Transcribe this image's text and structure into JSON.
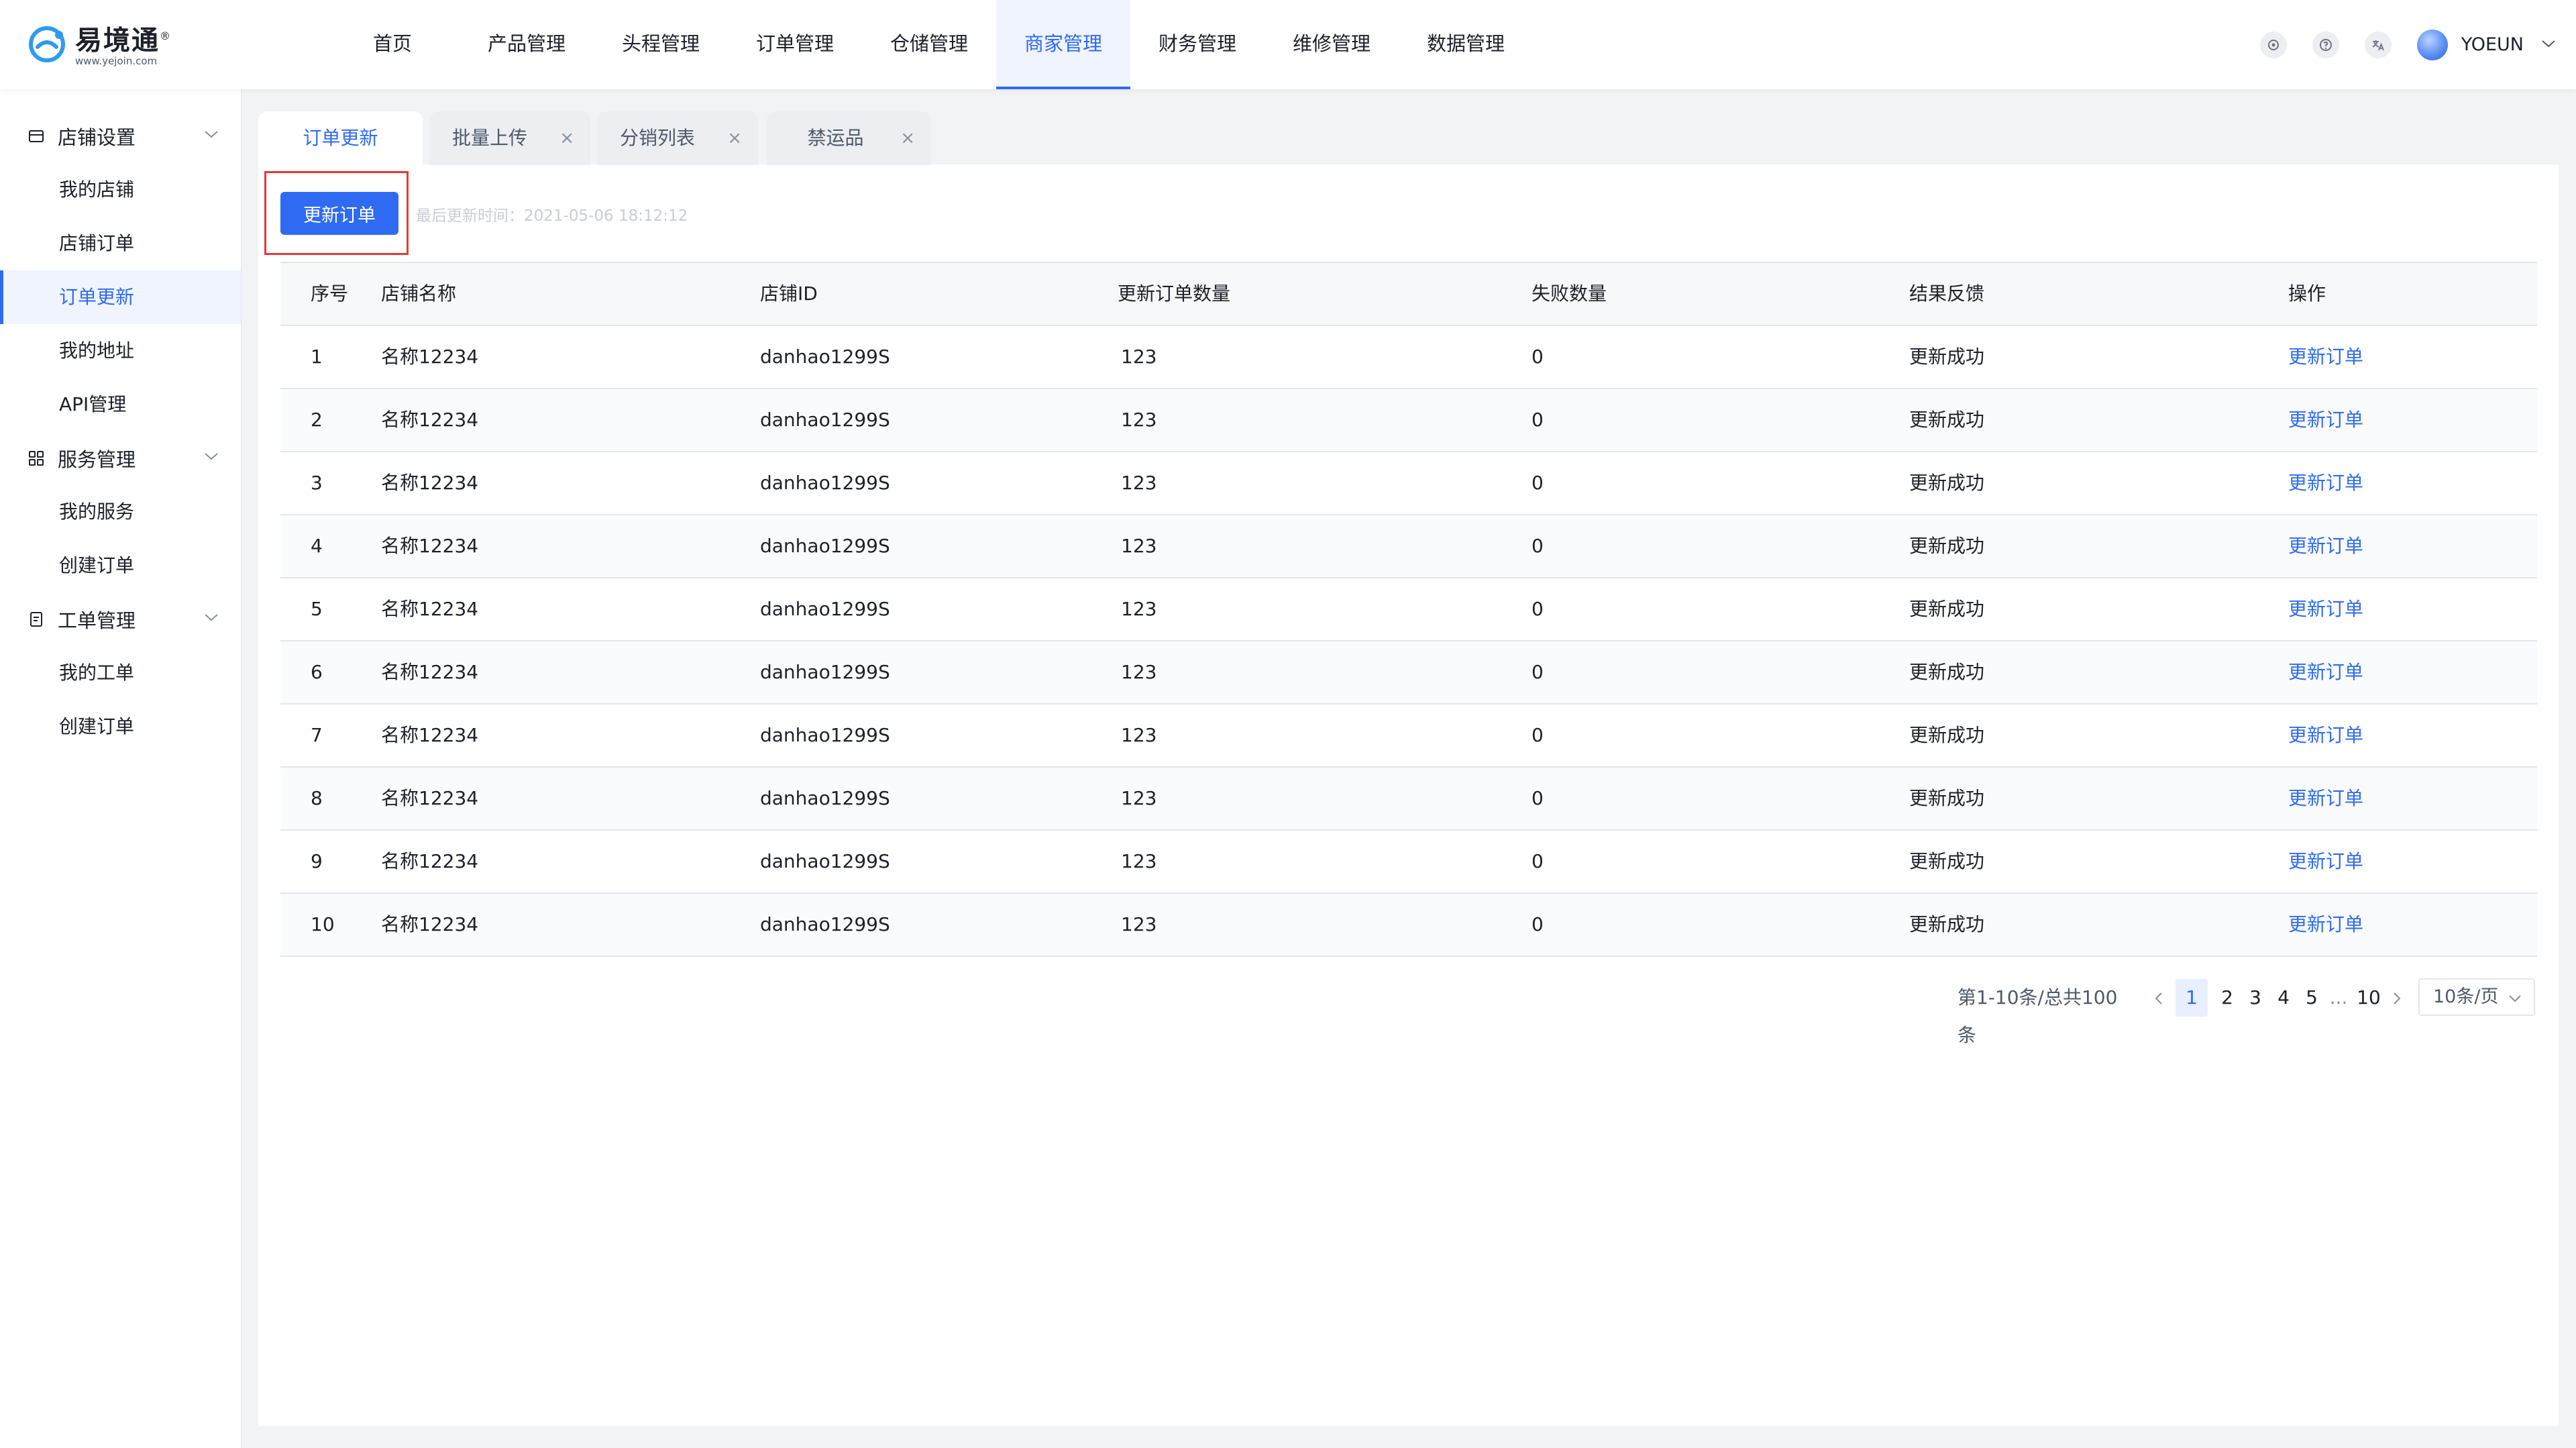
{
  "brand": {
    "name": "易境通",
    "mark": "®",
    "url": "www.yejoin.com"
  },
  "nav": [
    {
      "label": "首页"
    },
    {
      "label": "产品管理"
    },
    {
      "label": "头程管理"
    },
    {
      "label": "订单管理"
    },
    {
      "label": "仓储管理"
    },
    {
      "label": "商家管理",
      "active": true
    },
    {
      "label": "财务管理"
    },
    {
      "label": "维修管理"
    },
    {
      "label": "数据管理"
    }
  ],
  "header_icons": [
    "settings-icon",
    "help-icon",
    "translate-icon"
  ],
  "user": {
    "name": "YOEUN"
  },
  "sidebar": {
    "groups": [
      {
        "title": "店铺设置",
        "icon": "store-icon",
        "items": [
          "我的店铺",
          "店铺订单",
          "订单更新",
          "我的地址",
          "API管理"
        ]
      },
      {
        "title": "服务管理",
        "icon": "grid-icon",
        "items": [
          "我的服务",
          "创建订单"
        ]
      },
      {
        "title": "工单管理",
        "icon": "ticket-icon",
        "items": [
          "我的工单",
          "创建订单"
        ]
      }
    ],
    "active_item": "订单更新"
  },
  "tabs": [
    {
      "label": "订单更新",
      "active": true
    },
    {
      "label": "批量上传",
      "closable": true
    },
    {
      "label": "分销列表",
      "closable": true
    },
    {
      "label": "禁运品",
      "closable": true
    }
  ],
  "toolbar": {
    "update_button": "更新订单",
    "last_update": "最后更新时间：2021-05-06 18:12:12"
  },
  "table": {
    "columns": [
      "序号",
      "店铺名称",
      "店铺ID",
      "更新订单数量",
      "失败数量",
      "结果反馈",
      "操作"
    ],
    "rows": [
      [
        "1",
        "名称12234",
        "danhao1299S",
        "123",
        "0",
        "更新成功",
        "更新订单"
      ],
      [
        "2",
        "名称12234",
        "danhao1299S",
        "123",
        "0",
        "更新成功",
        "更新订单"
      ],
      [
        "3",
        "名称12234",
        "danhao1299S",
        "123",
        "0",
        "更新成功",
        "更新订单"
      ],
      [
        "4",
        "名称12234",
        "danhao1299S",
        "123",
        "0",
        "更新成功",
        "更新订单"
      ],
      [
        "5",
        "名称12234",
        "danhao1299S",
        "123",
        "0",
        "更新成功",
        "更新订单"
      ],
      [
        "6",
        "名称12234",
        "danhao1299S",
        "123",
        "0",
        "更新成功",
        "更新订单"
      ],
      [
        "7",
        "名称12234",
        "danhao1299S",
        "123",
        "0",
        "更新成功",
        "更新订单"
      ],
      [
        "8",
        "名称12234",
        "danhao1299S",
        "123",
        "0",
        "更新成功",
        "更新订单"
      ],
      [
        "9",
        "名称12234",
        "danhao1299S",
        "123",
        "0",
        "更新成功",
        "更新订单"
      ],
      [
        "10",
        "名称12234",
        "danhao1299S",
        "123",
        "0",
        "更新成功",
        "更新订单"
      ]
    ]
  },
  "pagination": {
    "summary": "第1-10条/总共100条",
    "pages": [
      "1",
      "2",
      "3",
      "4",
      "5",
      "...",
      "10"
    ],
    "current": "1",
    "page_size": "10条/页"
  },
  "colors": {
    "accent": "#2e6bf2",
    "highlight_border": "#e53935"
  }
}
